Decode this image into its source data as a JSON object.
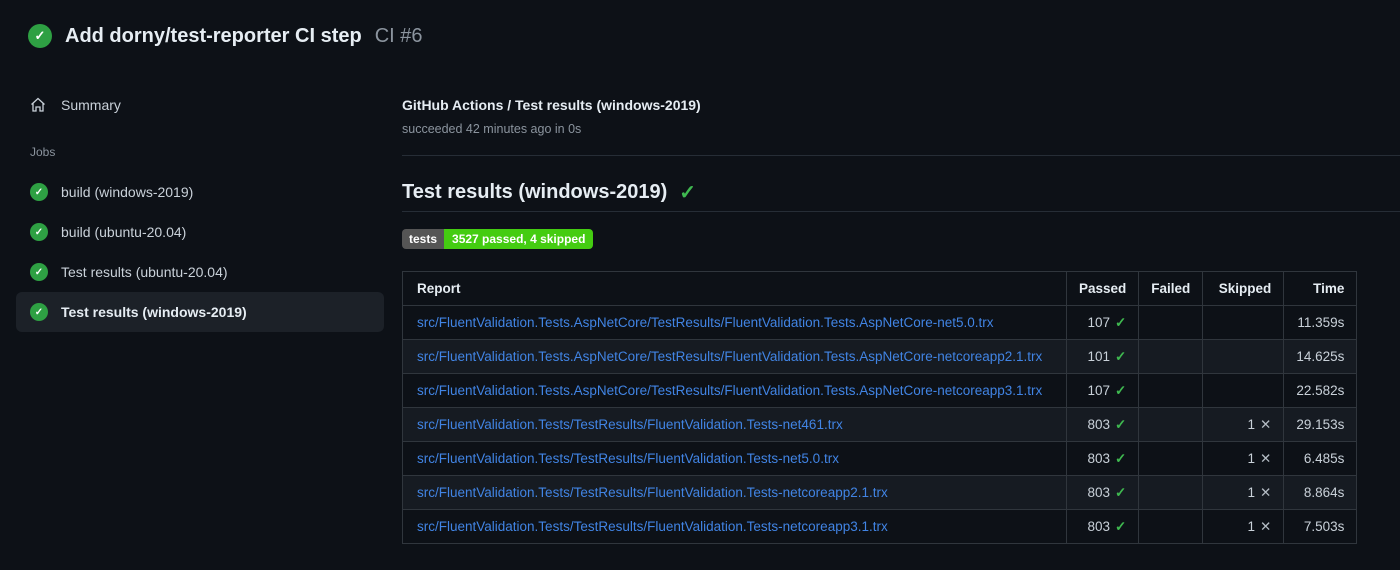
{
  "header": {
    "title": "Add dorny/test-reporter CI step",
    "run_number": "CI #6",
    "status_icon": "check-circle-icon"
  },
  "sidebar": {
    "summary_label": "Summary",
    "jobs_label": "Jobs",
    "jobs": [
      {
        "label": "build (windows-2019)",
        "selected": false
      },
      {
        "label": "build (ubuntu-20.04)",
        "selected": false
      },
      {
        "label": "Test results (ubuntu-20.04)",
        "selected": false
      },
      {
        "label": "Test results (windows-2019)",
        "selected": true
      }
    ]
  },
  "main": {
    "check_run_title": "GitHub Actions / Test results (windows-2019)",
    "check_run_status": "succeeded 42 minutes ago in 0s",
    "section_title": "Test results (windows-2019)",
    "badge": {
      "label": "tests",
      "value": "3527 passed, 4 skipped"
    },
    "table": {
      "headers": [
        "Report",
        "Passed",
        "Failed",
        "Skipped",
        "Time"
      ],
      "rows": [
        {
          "report": "src/FluentValidation.Tests.AspNetCore/TestResults/FluentValidation.Tests.AspNetCore-net5.0.trx",
          "passed": "107",
          "failed": "",
          "skipped": "",
          "time": "11.359s"
        },
        {
          "report": "src/FluentValidation.Tests.AspNetCore/TestResults/FluentValidation.Tests.AspNetCore-netcoreapp2.1.trx",
          "passed": "101",
          "failed": "",
          "skipped": "",
          "time": "14.625s"
        },
        {
          "report": "src/FluentValidation.Tests.AspNetCore/TestResults/FluentValidation.Tests.AspNetCore-netcoreapp3.1.trx",
          "passed": "107",
          "failed": "",
          "skipped": "",
          "time": "22.582s"
        },
        {
          "report": "src/FluentValidation.Tests/TestResults/FluentValidation.Tests-net461.trx",
          "passed": "803",
          "failed": "",
          "skipped": "1",
          "time": "29.153s"
        },
        {
          "report": "src/FluentValidation.Tests/TestResults/FluentValidation.Tests-net5.0.trx",
          "passed": "803",
          "failed": "",
          "skipped": "1",
          "time": "6.485s"
        },
        {
          "report": "src/FluentValidation.Tests/TestResults/FluentValidation.Tests-netcoreapp2.1.trx",
          "passed": "803",
          "failed": "",
          "skipped": "1",
          "time": "8.864s"
        },
        {
          "report": "src/FluentValidation.Tests/TestResults/FluentValidation.Tests-netcoreapp3.1.trx",
          "passed": "803",
          "failed": "",
          "skipped": "1",
          "time": "7.503s"
        }
      ]
    }
  },
  "icons": {
    "check_glyph": "✓",
    "x_glyph": "✕"
  },
  "colors": {
    "background": "#0d1117",
    "text": "#c9d1d9",
    "text_bright": "#e6edf3",
    "text_muted": "#8b949e",
    "link": "#4184e4",
    "success_green": "#2ea043",
    "check_green": "#3fb950",
    "badge_label_bg": "#555555",
    "badge_value_bg": "#44cc11",
    "table_border": "#30363d",
    "row_alt_bg": "#161b22",
    "selected_item_bg": "#1c2128"
  }
}
